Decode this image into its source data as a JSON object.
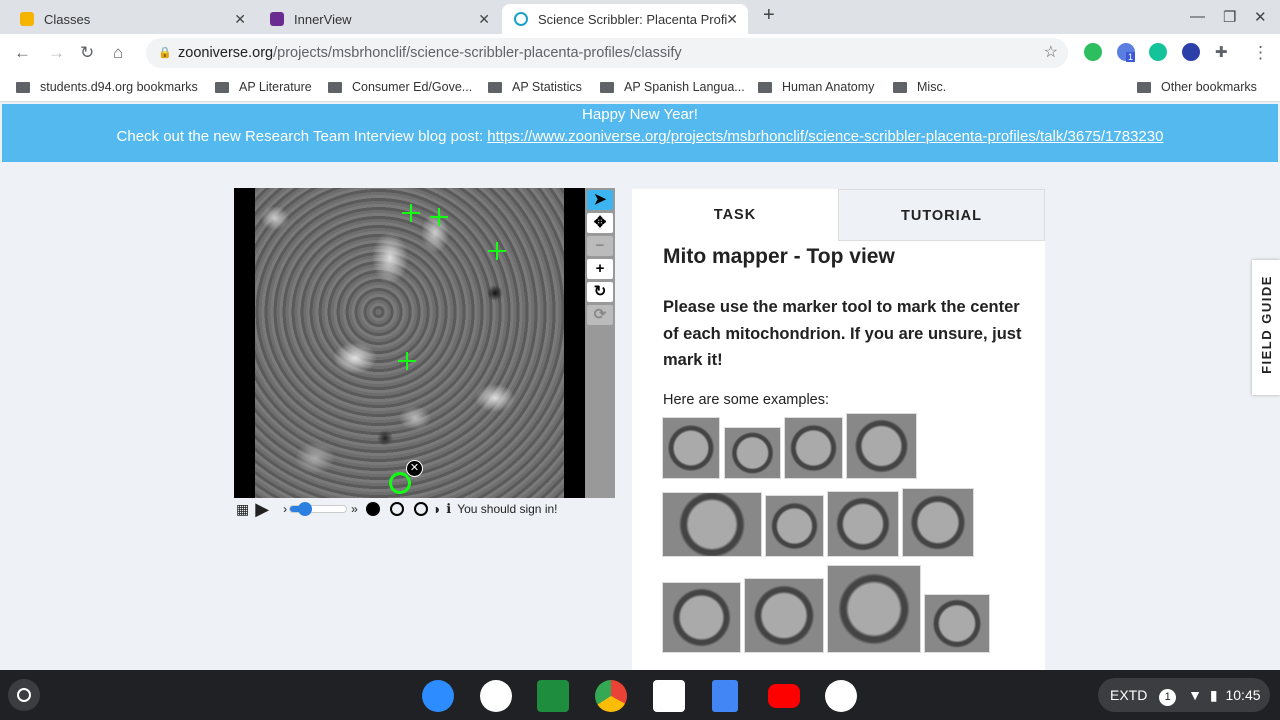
{
  "browser": {
    "tabs": [
      {
        "title": "Classes",
        "color": "#f4b400"
      },
      {
        "title": "InnerView",
        "color": "#6a2c91"
      },
      {
        "title": "Science Scribbler: Placenta Profi",
        "color": "#1ba0c8"
      }
    ],
    "url_domain": "zooniverse.org",
    "url_path": "/projects/msbrhonclif/science-scribbler-placenta-profiles/classify",
    "extension_badge": "1",
    "bookmarks": [
      "students.d94.org bookmarks",
      "AP Literature",
      "Consumer Ed/Gove...",
      "AP Statistics",
      "AP Spanish Langua...",
      "Human Anatomy",
      "Misc."
    ],
    "other_bookmarks": "Other bookmarks"
  },
  "banner": {
    "line1": "Happy New Year!",
    "line2_prefix": "Check out the new Research Team Interview blog post: ",
    "link": "https://www.zooniverse.org/projects/msbrhonclif/science-scribbler-placenta-profiles/talk/3675/1783230"
  },
  "viewer": {
    "sign_in_message": "You should sign in!",
    "marker_count": 5
  },
  "panel": {
    "tabs": [
      "TASK",
      "TUTORIAL"
    ],
    "title": "Mito mapper - Top view",
    "instructions": "Please use the marker tool to mark the center of each mitochondrion. If you are unsure, just mark it!",
    "examples_label": "Here are some examples:"
  },
  "field_guide": "FIELD GUIDE",
  "shelf": {
    "status": "EXTD",
    "notification_count": "1",
    "time": "10:45"
  }
}
